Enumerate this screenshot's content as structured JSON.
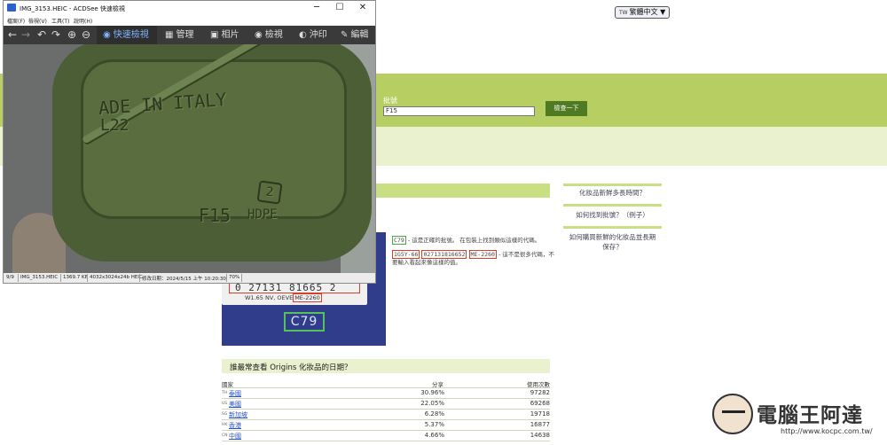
{
  "language_button": {
    "flag": "TW",
    "label": "繁體中文 ▼"
  },
  "batch_search": {
    "label": "批號",
    "value": "F15",
    "button": "檢查一下"
  },
  "faq": {
    "q1": "化妝品新鮮多長時間？",
    "q2": "如何找到批號？（例子）",
    "q3_line1": "如何購買新鮮的化妝品並長期",
    "q3_line2": "保存？"
  },
  "illustration": {
    "barcode": "0  27131 81665  2",
    "sub_prefix": "W1.65 NV, OEVE",
    "sub_chip": "ME-2260",
    "code": "C79"
  },
  "notes": {
    "correct_code": "C79",
    "correct_text": "- 這是正確的批號。 在包裝上找到類似這樣的代碼。",
    "wrong_1": "1G5Y-66",
    "wrong_2": "027131816652",
    "wrong_3": "ME-2260",
    "wrong_text": "- 這不是很多代碼，不",
    "wrong_text2": "要輸入看起來像這樣的值。"
  },
  "stats": {
    "title": "誰最常查看 Origins 化妝品的日期？",
    "headers": {
      "country": "國家",
      "share": "分享",
      "uses": "使用次數"
    },
    "rows": [
      {
        "code": "TH",
        "country": "泰國",
        "share": "30.96%",
        "uses": "97282"
      },
      {
        "code": "US",
        "country": "美國",
        "share": "22.05%",
        "uses": "69268"
      },
      {
        "code": "SG",
        "country": "新加坡",
        "share": "6.28%",
        "uses": "19718"
      },
      {
        "code": "HK",
        "country": "香港",
        "share": "5.37%",
        "uses": "16877"
      },
      {
        "code": "CN",
        "country": "中國",
        "share": "4.66%",
        "uses": "14638"
      }
    ]
  },
  "watermark": {
    "text": "電腦王阿達",
    "url": "http://www.kocpc.com.tw/"
  },
  "viewer": {
    "title": "IMG_3153.HEIC - ACDSee 快速檢視",
    "menus": [
      "檔案(F)",
      "檢視(V)",
      "工具(T)",
      "說明(H)"
    ],
    "modes": [
      {
        "icon": "eye-icon",
        "label": "快速檢視",
        "active": true
      },
      {
        "icon": "grid-icon",
        "label": "管理"
      },
      {
        "icon": "photos-icon",
        "label": "相片"
      },
      {
        "icon": "eye-icon",
        "label": "檢視"
      },
      {
        "icon": "develop-icon",
        "label": "沖印"
      },
      {
        "icon": "edit-icon",
        "label": "編輯"
      }
    ],
    "photo_text": {
      "line1": "ADE IN ITALY",
      "line2": "L22",
      "code": "F15",
      "recycle_num": "2",
      "material": "HDPE"
    },
    "status": {
      "index": "9/9",
      "filename": "IMG_3153.HEIC",
      "size": "1369.7 KB",
      "dims": "4032x3024x24b HEIC",
      "date": "修改日期：2024/5/15 上午 10:20:30",
      "zoom": "70%"
    }
  }
}
